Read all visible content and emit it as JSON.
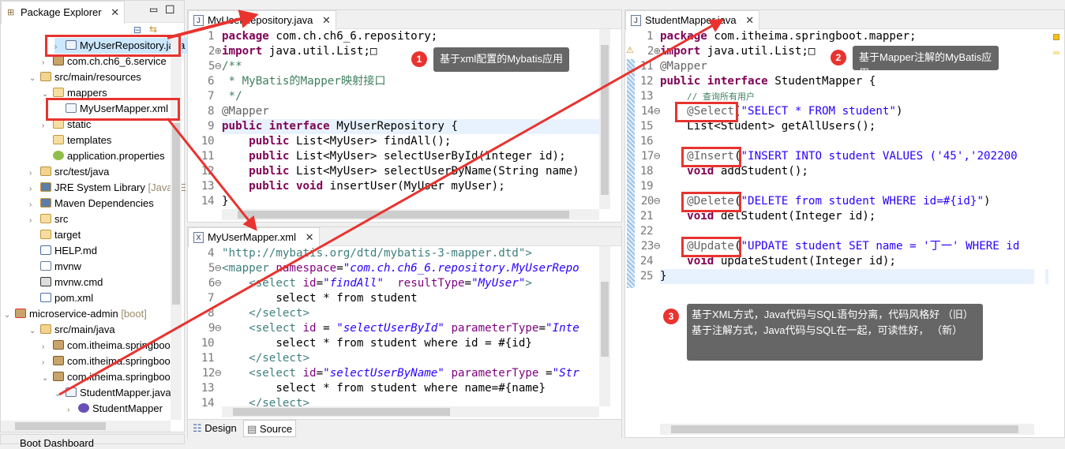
{
  "package_explorer": {
    "title": "Package Explorer",
    "items": [
      {
        "label": "MyUserRepository.java",
        "indent": 4,
        "twisty": ">",
        "icon": "java-interface-icon",
        "selected": true
      },
      {
        "label": "com.ch.ch6_6.service",
        "indent": 3,
        "twisty": ">",
        "icon": "package-icon"
      },
      {
        "label": "src/main/resources",
        "indent": 2,
        "twisty": "v",
        "icon": "source-folder-icon"
      },
      {
        "label": "mappers",
        "indent": 3,
        "twisty": "v",
        "icon": "folder-icon"
      },
      {
        "label": "MyUserMapper.xml",
        "indent": 4,
        "twisty": "",
        "icon": "xml-file-icon"
      },
      {
        "label": "static",
        "indent": 3,
        "twisty": ">",
        "icon": "folder-icon"
      },
      {
        "label": "templates",
        "indent": 3,
        "twisty": "",
        "icon": "folder-icon"
      },
      {
        "label": "application.properties",
        "indent": 3,
        "twisty": "",
        "icon": "properties-icon"
      },
      {
        "label": "src/test/java",
        "indent": 2,
        "twisty": ">",
        "icon": "source-folder-icon"
      },
      {
        "label": "JRE System Library",
        "suffix": " [JavaSE",
        "indent": 2,
        "twisty": ">",
        "icon": "library-icon"
      },
      {
        "label": "Maven Dependencies",
        "indent": 2,
        "twisty": ">",
        "icon": "library-icon"
      },
      {
        "label": "src",
        "indent": 2,
        "twisty": ">",
        "icon": "folder-icon"
      },
      {
        "label": "target",
        "indent": 2,
        "twisty": "",
        "icon": "folder-icon"
      },
      {
        "label": "HELP.md",
        "indent": 2,
        "twisty": "",
        "icon": "markdown-file-icon"
      },
      {
        "label": "mvnw",
        "indent": 2,
        "twisty": "",
        "icon": "text-file-icon"
      },
      {
        "label": "mvnw.cmd",
        "indent": 2,
        "twisty": "",
        "icon": "cmd-file-icon"
      },
      {
        "label": "pom.xml",
        "indent": 2,
        "twisty": "",
        "icon": "maven-pom-icon"
      },
      {
        "label": "microservice-admin",
        "suffix": " [boot]",
        "indent": 0,
        "twisty": "v",
        "icon": "project-icon"
      },
      {
        "label": "src/main/java",
        "indent": 2,
        "twisty": "v",
        "icon": "source-folder-icon"
      },
      {
        "label": "com.itheima.springboot",
        "indent": 3,
        "twisty": ">",
        "icon": "package-icon"
      },
      {
        "label": "com.itheima.springboot.",
        "indent": 3,
        "twisty": ">",
        "icon": "package-icon"
      },
      {
        "label": "com.itheima.springboot.",
        "indent": 3,
        "twisty": "v",
        "icon": "package-icon"
      },
      {
        "label": "StudentMapper.java",
        "indent": 4,
        "twisty": "v",
        "icon": "java-interface-icon"
      },
      {
        "label": "StudentMapper",
        "indent": 5,
        "twisty": ">",
        "icon": "interface-icon"
      }
    ],
    "bottom_tab": "Boot Dashboard"
  },
  "repo_editor": {
    "tab": "MyUserRepository.java",
    "line_numbers": [
      "1",
      "2⊕",
      "5⊖",
      "6",
      "7",
      "8",
      "9",
      "10",
      "11",
      "12",
      "13",
      "14"
    ],
    "lines": [
      [
        [
          "kw",
          "package"
        ],
        [
          "tx",
          " com.ch.ch6_6.repository;"
        ]
      ],
      [
        [
          "kw",
          "import"
        ],
        [
          "tx",
          " java.util.List;"
        ],
        [
          "tx",
          "□"
        ]
      ],
      [
        [
          "cm",
          "/**"
        ]
      ],
      [
        [
          "cm",
          " * MyBatis的Mapper映射接口"
        ]
      ],
      [
        [
          "cm",
          " */"
        ]
      ],
      [
        [
          "an",
          "@Mapper"
        ]
      ],
      [
        [
          "kw",
          "public interface"
        ],
        [
          "tx",
          " MyUserRepository {"
        ]
      ],
      [
        [
          "tx",
          "    "
        ],
        [
          "kw",
          "public"
        ],
        [
          "tx",
          " List<MyUser> findAll();"
        ]
      ],
      [
        [
          "tx",
          "    "
        ],
        [
          "kw",
          "public"
        ],
        [
          "tx",
          " List<MyUser> selectUserById(Integer id);"
        ]
      ],
      [
        [
          "tx",
          "    "
        ],
        [
          "kw",
          "public"
        ],
        [
          "tx",
          " List<MyUser> selectUserByName(String name)"
        ]
      ],
      [
        [
          "tx",
          "    "
        ],
        [
          "kw",
          "public void"
        ],
        [
          "tx",
          " insertUser(MyUser myUser);"
        ]
      ],
      [
        [
          "tx",
          "}"
        ]
      ]
    ]
  },
  "xml_editor": {
    "tab": "MyUserMapper.xml",
    "line_numbers": [
      "4",
      "5⊖",
      "6⊖",
      "7",
      "8",
      "9⊖",
      "10",
      "11",
      "12⊖",
      "13",
      "14"
    ],
    "lines": [
      [
        [
          "tg",
          "\"http://mybatis.org/dtd/mybatis-3-mapper.dtd\">"
        ]
      ],
      [
        [
          "tg",
          "<mapper "
        ],
        [
          "at",
          "namespace"
        ],
        [
          "tx",
          "="
        ],
        [
          "av",
          "\"com.ch.ch6_6.repository.MyUserRepo"
        ]
      ],
      [
        [
          "tg",
          "    <select "
        ],
        [
          "at",
          "id"
        ],
        [
          "tx",
          "="
        ],
        [
          "av",
          "\"findAll\""
        ],
        [
          "tx",
          "  "
        ],
        [
          "at",
          "resultType"
        ],
        [
          "tx",
          "="
        ],
        [
          "av",
          "\"MyUser\""
        ],
        [
          "tg",
          ">"
        ]
      ],
      [
        [
          "tx",
          "        select * from student"
        ]
      ],
      [
        [
          "tg",
          "    </select>"
        ]
      ],
      [
        [
          "tg",
          "    <select "
        ],
        [
          "at",
          "id"
        ],
        [
          "tx",
          " = "
        ],
        [
          "av",
          "\"selectUserById\""
        ],
        [
          "tx",
          " "
        ],
        [
          "at",
          "parameterType"
        ],
        [
          "tx",
          "="
        ],
        [
          "av",
          "\"Inte"
        ]
      ],
      [
        [
          "tx",
          "        select * from student where id = #{id}"
        ]
      ],
      [
        [
          "tg",
          "    </select>"
        ]
      ],
      [
        [
          "tg",
          "    <select "
        ],
        [
          "at",
          "id"
        ],
        [
          "tx",
          "="
        ],
        [
          "av",
          "\"selectUserByName\""
        ],
        [
          "tx",
          " "
        ],
        [
          "at",
          "parameterType"
        ],
        [
          "tx",
          " ="
        ],
        [
          "av",
          "\"Str"
        ]
      ],
      [
        [
          "tx",
          "        select * from student where name=#{name}"
        ]
      ],
      [
        [
          "tg",
          "    </select>"
        ]
      ]
    ],
    "bottom_tabs": [
      "Design",
      "Source"
    ]
  },
  "student_editor": {
    "tab": "StudentMapper.java",
    "line_numbers": [
      "1",
      "2⊕",
      "11",
      "12",
      "13",
      "14⊖",
      "15",
      "16",
      "17⊖",
      "18",
      "19",
      "20⊖",
      "21",
      "22",
      "23⊖",
      "24",
      "25"
    ],
    "lines": [
      [
        [
          "kw",
          "package"
        ],
        [
          "tx",
          " com.itheima.springboot.mapper;"
        ]
      ],
      [
        [
          "kw",
          "import"
        ],
        [
          "tx",
          " java.util.List;"
        ],
        [
          "tx",
          "□"
        ]
      ],
      [
        [
          "an",
          "@Mapper"
        ]
      ],
      [
        [
          "kw",
          "public interface"
        ],
        [
          "tx",
          " StudentMapper {"
        ]
      ],
      [
        [
          "tx",
          "    "
        ],
        [
          "cmt",
          "// 查询所有用户"
        ]
      ],
      [
        [
          "tx",
          "    "
        ],
        [
          "an",
          "@Select"
        ],
        [
          "tx",
          "("
        ],
        [
          "st",
          "\"SELECT * FROM student\""
        ],
        [
          "tx",
          ")"
        ]
      ],
      [
        [
          "tx",
          "    List<Student> getAllUsers();"
        ]
      ],
      [
        [
          "tx",
          ""
        ]
      ],
      [
        [
          "tx",
          "    "
        ],
        [
          "an",
          "@Insert"
        ],
        [
          "tx",
          "("
        ],
        [
          "st",
          "\"INSERT INTO student VALUES ('45','202200"
        ]
      ],
      [
        [
          "tx",
          "    "
        ],
        [
          "kw",
          "void"
        ],
        [
          "tx",
          " addStudent();"
        ]
      ],
      [
        [
          "tx",
          ""
        ]
      ],
      [
        [
          "tx",
          "    "
        ],
        [
          "an",
          "@Delete"
        ],
        [
          "tx",
          "("
        ],
        [
          "st",
          "\"DELETE from student WHERE id=#{id}\""
        ],
        [
          "tx",
          ")"
        ]
      ],
      [
        [
          "tx",
          "    "
        ],
        [
          "kw",
          "void"
        ],
        [
          "tx",
          " delStudent(Integer id);"
        ]
      ],
      [
        [
          "tx",
          ""
        ]
      ],
      [
        [
          "tx",
          "    "
        ],
        [
          "an",
          "@Update"
        ],
        [
          "tx",
          "("
        ],
        [
          "st",
          "\"UPDATE student SET name = '丁一' WHERE id"
        ]
      ],
      [
        [
          "tx",
          "    "
        ],
        [
          "kw",
          "void"
        ],
        [
          "tx",
          " updateStudent(Integer id);"
        ]
      ],
      [
        [
          "tx",
          "}"
        ]
      ]
    ]
  },
  "callouts": [
    {
      "number": "1",
      "text": "基于xml配置的Mybatis应用"
    },
    {
      "number": "2",
      "text": "基于Mapper注解的MyBatis应用"
    },
    {
      "number": "3",
      "line1": "基于XML方式，Java代码与SQL语句分离，代码风格好  （旧）",
      "line2": "基于注解方式，Java代码与SQL在一起，可读性好，       （新）"
    }
  ],
  "colors": {
    "annotation_red": "#e8332f",
    "callout_bg": "#666666",
    "keyword": "#7f0055"
  }
}
